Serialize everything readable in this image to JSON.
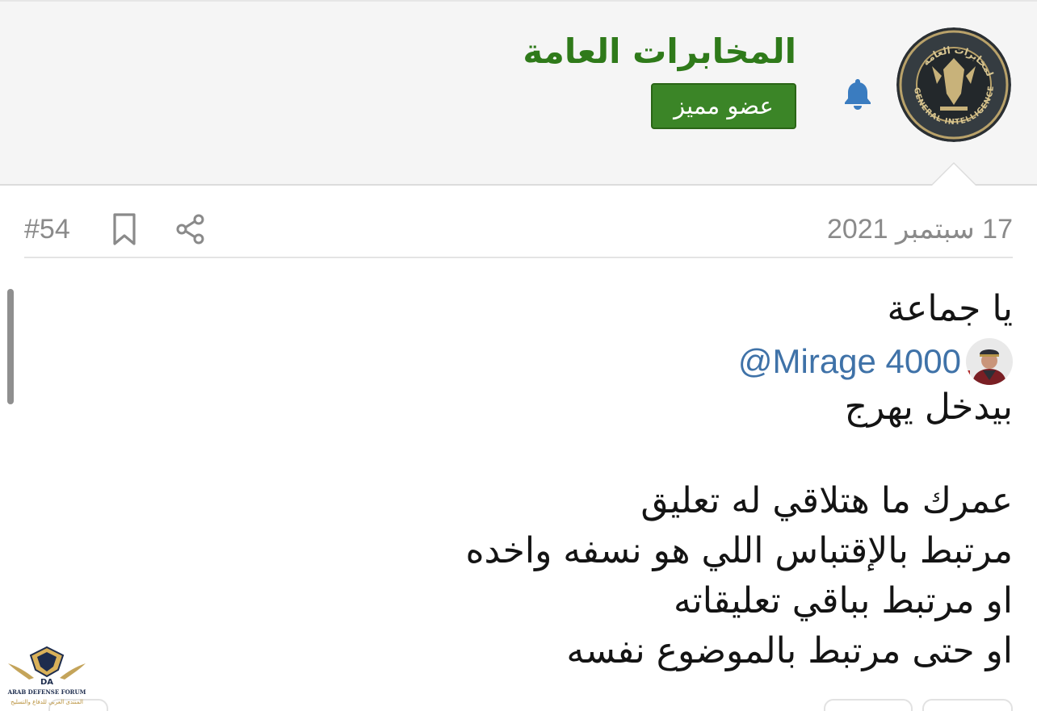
{
  "user": {
    "name": "المخابرات العامة",
    "badge": "عضو مميز",
    "avatar_icon": "general-intelligence-service-emblem",
    "avatar_text": "GENERAL INTELLIGENCE SERVICE",
    "avatar_arabic": "المخابرات العامة"
  },
  "post": {
    "date": "17 سبتمبر 2021",
    "number": "#54",
    "actions": [
      "share-icon",
      "bookmark-icon"
    ],
    "lines": {
      "greeting": "يا جماعة",
      "mention": "@Mirage 4000",
      "line3": "بيدخل يهرج",
      "line4": "عمرك ما هتلاقي له تعليق",
      "line5": "مرتبط بالإقتباس اللي هو نسفه واخده",
      "line6": "او مرتبط بباقي تعليقاته",
      "line7": "او حتى مرتبط بالموضوع نفسه"
    }
  },
  "watermark": {
    "name": "ARAB DEFENSE FORUM",
    "arabic": "المنتدى العربي للدفاع والتسليح",
    "logo": "DA"
  },
  "colors": {
    "username": "#2f7a1a",
    "badge_bg": "#3b8527",
    "bell": "#3a7cc0",
    "mention": "#3f72a8",
    "meta_text": "#8a8a8a",
    "header_bg": "#f5f5f5"
  }
}
